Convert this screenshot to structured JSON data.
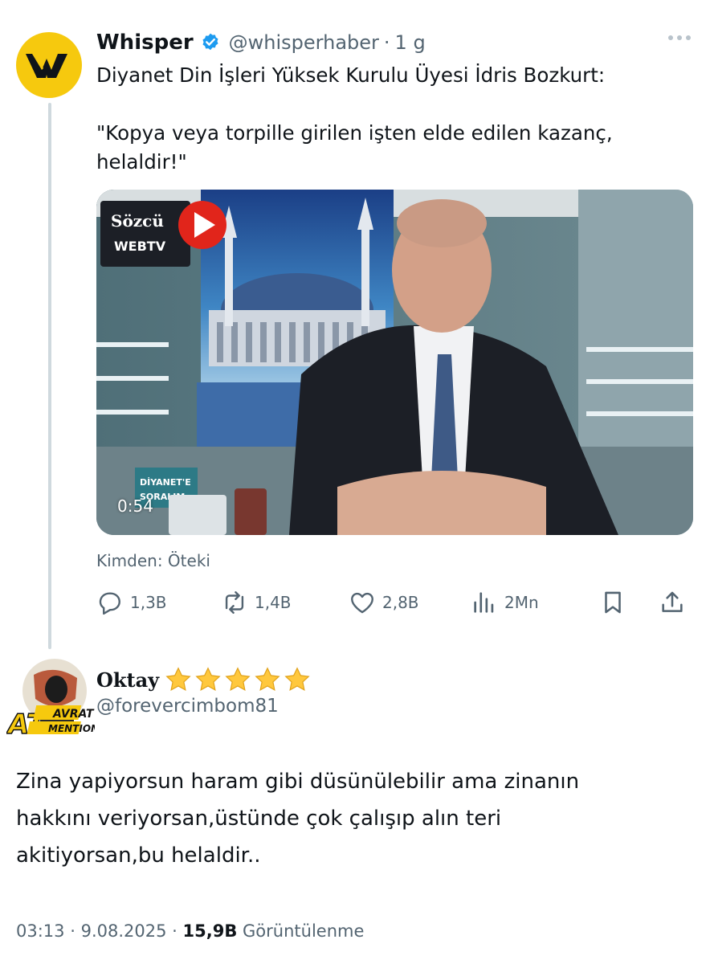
{
  "tweet": {
    "author_name": "Whisper",
    "handle": "@whisperhaber",
    "time": "1 g",
    "text_line1": "Diyanet Din İşleri Yüksek Kurulu Üyesi İdris Bozkurt:",
    "text_line2": "\"Kopya veya torpille girilen işten elde edilen kazanç,\nhelaldir!\"",
    "media": {
      "duration": "0:54",
      "overlay_logo_top": "Sözcü",
      "overlay_logo_bottom": "WEBTV",
      "show_sign_top": "DİYANET'E",
      "show_sign_bottom": "SORALIM"
    },
    "source_label": "Kimden: Öteki",
    "stats": {
      "replies": "1,3B",
      "retweets": "1,4B",
      "likes": "2,8B",
      "views": "2Mn"
    }
  },
  "reply": {
    "author_name": "Oktay",
    "star_count": 5,
    "handle": "@forevercimbom81",
    "avatar_text_top": "AVRAT",
    "avatar_text_left": "AT",
    "avatar_text_bottom": "MENTION",
    "text": "Zina yapiyorsun haram gibi düsünülebilir ama zinanın\nhakkını veriyorsan,üstünde çok çalışıp alın teri\nakitiyorsan,bu helaldir..",
    "time": "03:13",
    "date": "9.08.2025",
    "views_count": "15,9B",
    "views_label": "Görüntülenme"
  },
  "colors": {
    "accent": "#1d9bf0",
    "brand_yellow": "#f6c90e",
    "muted_text": "#536471",
    "thread_line": "#cfd9de",
    "star": "#ffc83d"
  },
  "icons": [
    "whisper-logo",
    "verified-badge-icon",
    "more-icon",
    "reply-icon",
    "retweet-icon",
    "like-icon",
    "views-icon",
    "bookmark-icon",
    "share-icon",
    "star-icon",
    "play-icon"
  ]
}
